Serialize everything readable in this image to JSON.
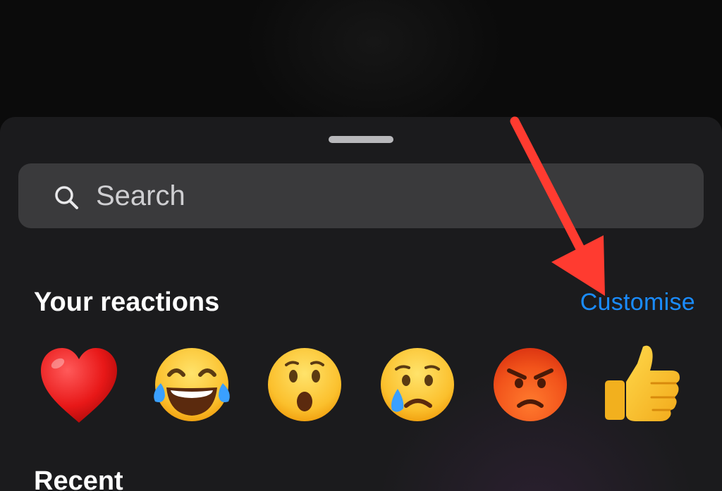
{
  "search": {
    "placeholder": "Search"
  },
  "reactions": {
    "title": "Your reactions",
    "customise_label": "Customise",
    "emojis": [
      "red-heart",
      "face-with-tears-of-joy",
      "face-with-open-mouth",
      "crying-face",
      "angry-face",
      "thumbs-up"
    ]
  },
  "recent": {
    "title": "Recent"
  },
  "colors": {
    "accent": "#1a8cff",
    "annotation_arrow": "#ff3b30",
    "sheet_bg": "#1b1b1d",
    "search_bg": "#3a3a3c"
  }
}
